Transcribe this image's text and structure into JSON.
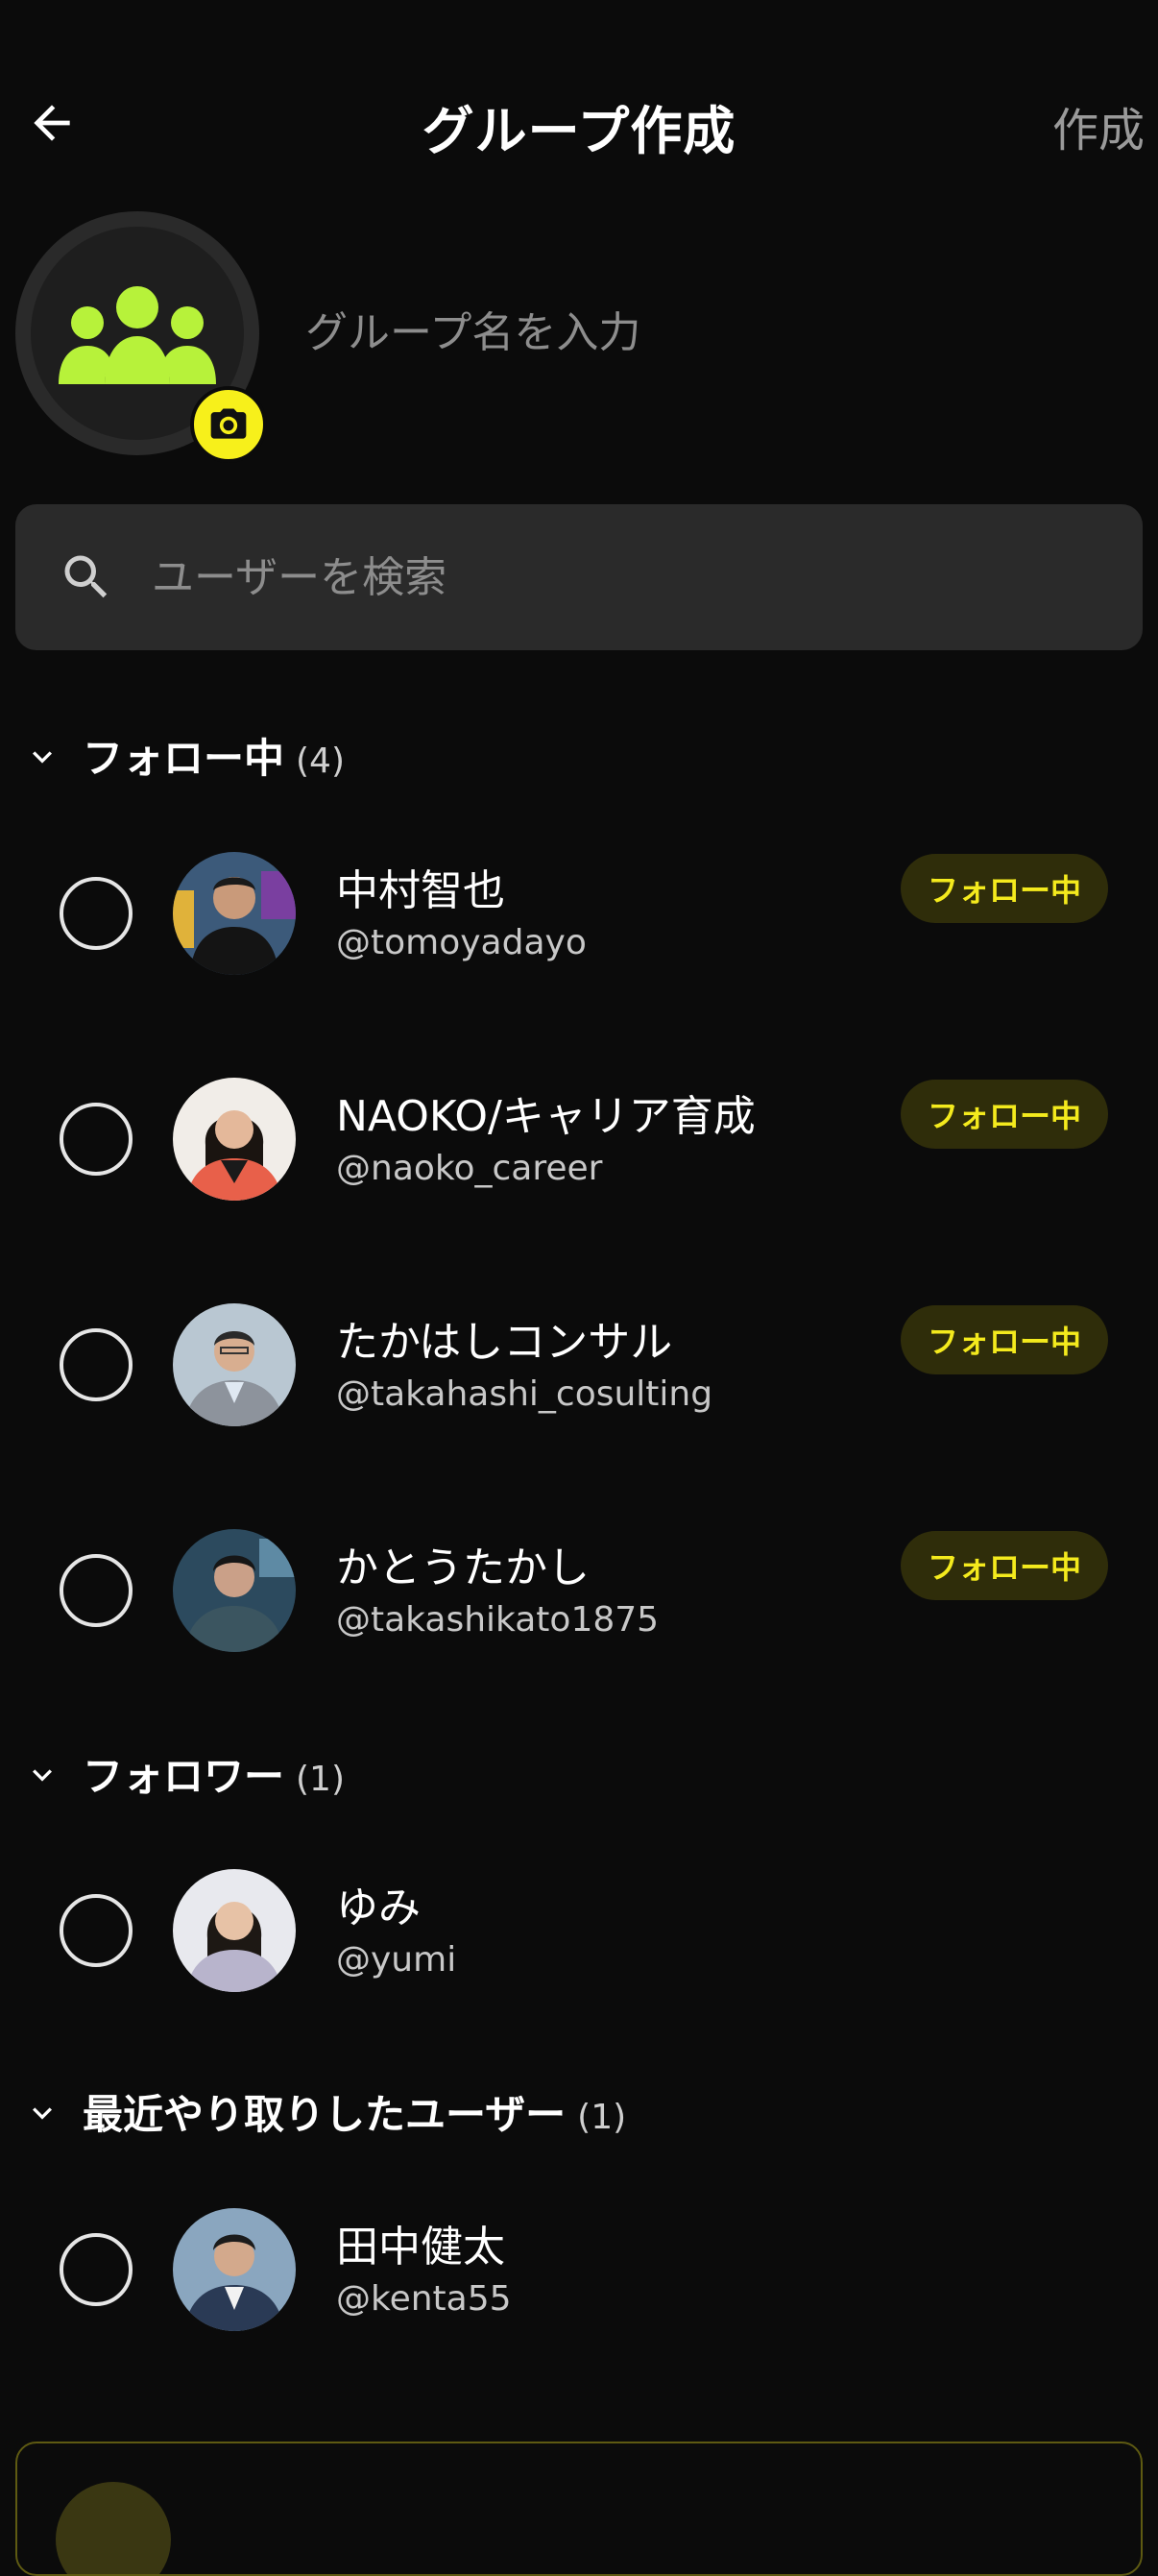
{
  "header": {
    "title": "グループ作成",
    "create_label": "作成"
  },
  "group": {
    "name_placeholder": "グループ名を入力",
    "avatar_icon": "group-icon",
    "avatar_icon_color": "#b7f23a",
    "camera_icon": "camera-icon",
    "camera_badge_color": "#f7f01b"
  },
  "search": {
    "placeholder": "ユーザーを検索"
  },
  "sections": {
    "following": {
      "title": "フォロー中",
      "count": "(4)",
      "users": [
        {
          "name": "中村智也",
          "handle": "@tomoyadayo",
          "badge": "フォロー中"
        },
        {
          "name": "NAOKO/キャリア育成",
          "handle": "@naoko_career",
          "badge": "フォロー中"
        },
        {
          "name": "たかはしコンサル",
          "handle": "@takahashi_cosulting",
          "badge": "フォロー中"
        },
        {
          "name": "かとうたかし",
          "handle": "@takashikato1875",
          "badge": "フォロー中"
        }
      ]
    },
    "followers": {
      "title": "フォロワー",
      "count": "(1)",
      "users": [
        {
          "name": "ゆみ",
          "handle": "@yumi"
        }
      ]
    },
    "recent": {
      "title": "最近やり取りしたユーザー",
      "count": "(1)",
      "users": [
        {
          "name": "田中健太",
          "handle": "@kenta55"
        }
      ]
    }
  },
  "colors": {
    "background": "#0b0b0b",
    "accent_yellow": "#f4ea1d",
    "badge_bg": "#2f2d0a"
  }
}
